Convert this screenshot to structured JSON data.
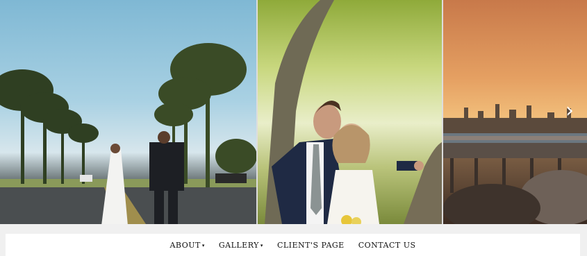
{
  "navigation": {
    "items": [
      {
        "label": "ABOUT",
        "has_dropdown": true
      },
      {
        "label": "GALLERY",
        "has_dropdown": true
      },
      {
        "label": "CLIENT'S PAGE",
        "has_dropdown": false
      },
      {
        "label": "CONTACT US",
        "has_dropdown": false
      }
    ],
    "caret": "▾"
  },
  "slider": {
    "next_arrow_icon": "chevron-right-icon",
    "next_arrow_glyph": "›",
    "panels": [
      {
        "image": "couple-walking-palm-road-photo"
      },
      {
        "image": "couple-embracing-under-tree-photo"
      },
      {
        "image": "city-skyline-sunset-pier-photo"
      }
    ]
  }
}
